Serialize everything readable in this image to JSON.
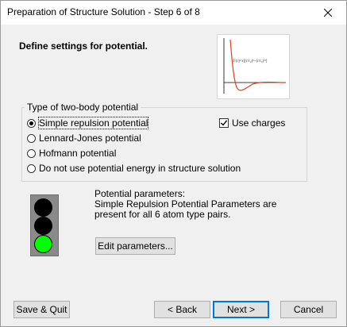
{
  "window": {
    "title": "Preparation of Structure Solution - Step 6 of 8"
  },
  "heading": "Define settings for potential.",
  "graph": {
    "formula": "F(r)=ε[(r/r₀)ⁿ−(r/r₀)ᵐ]"
  },
  "potential_group": {
    "legend": "Type of two-body potential",
    "options": [
      {
        "label": "Simple repulsion potential",
        "checked": true
      },
      {
        "label": "Lennard-Jones potential",
        "checked": false
      },
      {
        "label": "Hofmann potential",
        "checked": false
      },
      {
        "label": "Do not use potential energy in structure solution",
        "checked": false
      }
    ],
    "use_charges": {
      "label": "Use charges",
      "checked": true
    }
  },
  "traffic_light": {
    "top": "#000000",
    "middle": "#000000",
    "bottom": "#00ff00"
  },
  "params": {
    "title": "Potential parameters:",
    "description": "Simple Repulsion Potential Parameters are present for all 6 atom type pairs.",
    "edit_button": "Edit parameters..."
  },
  "footer": {
    "save_quit": "Save & Quit",
    "back": "< Back",
    "next": "Next >",
    "cancel": "Cancel"
  }
}
